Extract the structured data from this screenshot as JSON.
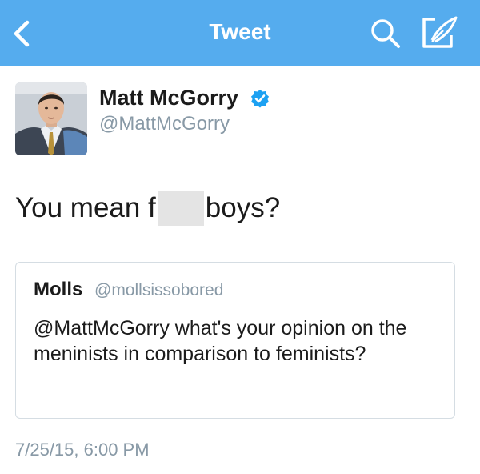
{
  "header": {
    "title": "Tweet",
    "back_icon": "chevron-left-icon",
    "search_icon": "search-icon",
    "compose_icon": "compose-icon",
    "background_color": "#55acee"
  },
  "tweet": {
    "author": {
      "name": "Matt McGorry",
      "handle": "@MattMcGorry",
      "verified": true,
      "verified_color": "#1da1f2"
    },
    "text_before": "You mean f",
    "text_after": "boys?",
    "timestamp": "7/25/15, 6:00 PM"
  },
  "quoted_tweet": {
    "author_name": "Molls",
    "author_handle": "@mollsissobored",
    "text": "@MattMcGorry what's your opinion on the meninists in comparison to feminists?"
  }
}
